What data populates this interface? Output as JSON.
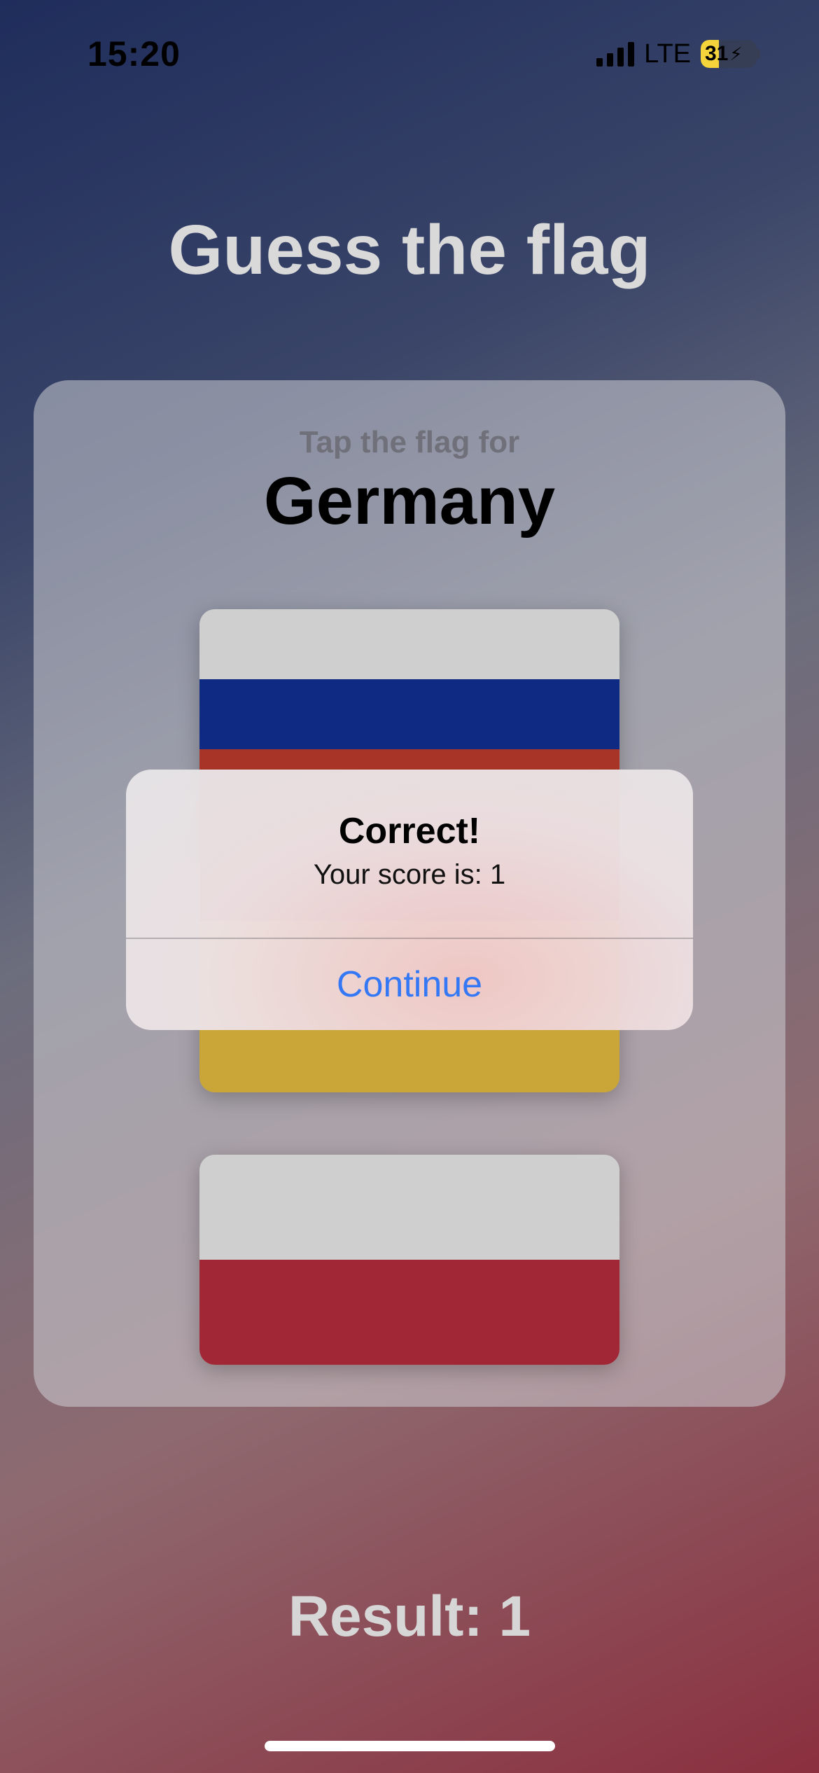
{
  "status_bar": {
    "time": "15:20",
    "network": "LTE",
    "battery_level": "31",
    "battery_color": "#f5d33a",
    "signal_icon": "signal-bars-icon",
    "charging_icon": "bolt-icon"
  },
  "app": {
    "title": "Guess the flag",
    "prompt": "Tap the flag for",
    "country": "Germany",
    "result": "Result: 1"
  },
  "flags": [
    {
      "name": "flag-russia",
      "stripes": [
        "#cfcfcf",
        "#0f2a82",
        "#a83428",
        "#c9a637"
      ]
    },
    {
      "name": "flag-poland",
      "stripes": [
        "#cfcfcf",
        "#a12736"
      ]
    }
  ],
  "alert": {
    "title": "Correct!",
    "message": "Your score is: 1",
    "button_label": "Continue",
    "button_color": "#3478f6"
  }
}
